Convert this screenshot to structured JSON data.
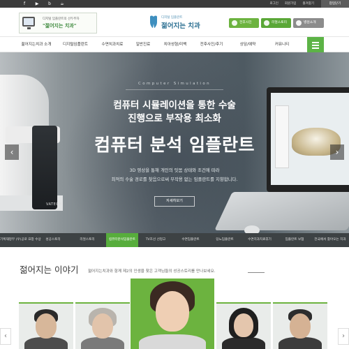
{
  "topbar": {
    "social": [
      "f",
      "▶",
      "b",
      "☕"
    ],
    "links": [
      "로그인",
      "회원가입",
      "즐겨찾기"
    ],
    "close_label": "팝업닫기"
  },
  "header": {
    "ad_line1": "디지털 임플란트의 선두주자",
    "ad_line2": "\"젊어지는 치과\"",
    "logo_sub": "디지털 임플란트",
    "logo_main": "젊어지는 치과",
    "buttons": [
      "전후사진",
      "리얼스토리",
      "병원소개"
    ]
  },
  "nav": {
    "items": [
      "젊어지는치과 소개",
      "디지털임플란트",
      "수면치과치료",
      "일반진료",
      "치아성형/미백",
      "전후사진/후기",
      "상담/예약",
      "커뮤니티"
    ]
  },
  "hero": {
    "subtitle": "Computer Simulation",
    "line1": "컴퓨터 시뮬레이션을 통한 수술",
    "line2": "진행으로 부작용 최소화",
    "title": "컴퓨터 분석 임플란트",
    "desc1": "3D 영상을 통해 개인의 잇몸 상태와 조건에 따라",
    "desc2": "최적의 수술 경로를 찾음으로써 부작용 없는 임플란트를 지향합니다.",
    "button": "자세히보기",
    "brand": "VATECH",
    "prev": "‹",
    "next": "›"
  },
  "strip": {
    "items": [
      "기획재정부 (우)공로 표창 수상",
      "성공스토리",
      "리얼스토리",
      "컴퓨터분석임플란트",
      "TV조선 선정고",
      "수면임플란트",
      "당뇨임플란트",
      "수면치과치료후기",
      "임플란트 보험",
      "전국에서 찾아오는 치과"
    ],
    "active_index": 3
  },
  "story": {
    "title": "젊어지는 이야기",
    "desc": "젊어지는치과와 함께 제2의 인생을 찾은 고객님들의 성공스토리를 만나보세요.",
    "prev": "‹",
    "next": "›"
  },
  "colors": {
    "accent": "#6cb33f",
    "topbar": "#3b3b3b",
    "logo": "#2b6f91"
  }
}
